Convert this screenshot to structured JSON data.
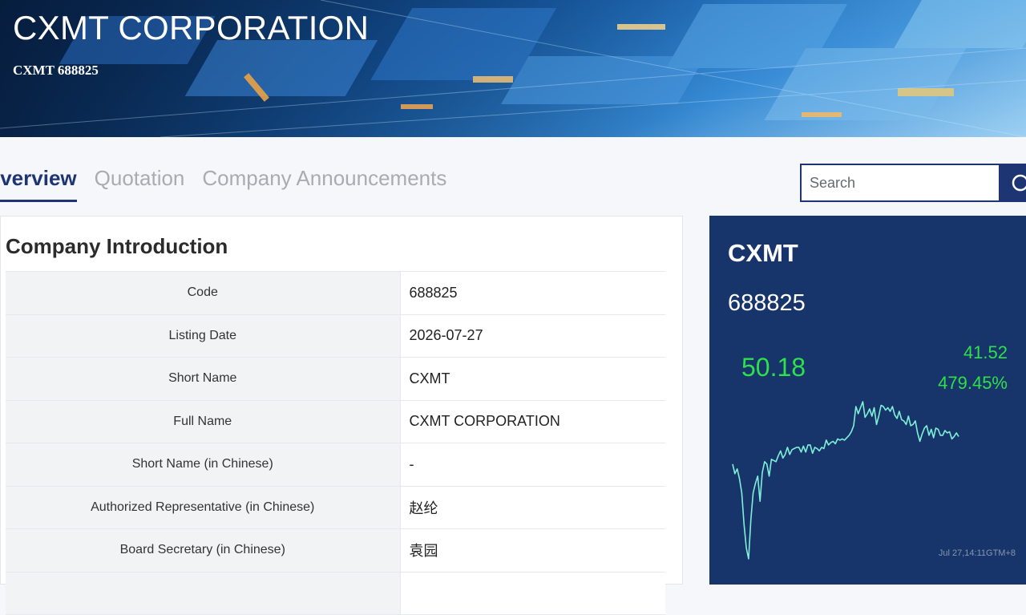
{
  "hero": {
    "title": "CXMT CORPORATION",
    "subtitle": "CXMT 688825"
  },
  "tabs": [
    {
      "label": "Overview",
      "active": true
    },
    {
      "label": "Quotation",
      "active": false
    },
    {
      "label": "Company Announcements",
      "active": false
    }
  ],
  "search": {
    "placeholder": "Search",
    "value": ""
  },
  "intro": {
    "title": "Company Introduction",
    "rows": [
      {
        "key": "Code",
        "value": "688825"
      },
      {
        "key": "Listing Date",
        "value": "2026-07-27"
      },
      {
        "key": "Short Name",
        "value": "CXMT"
      },
      {
        "key": "Full Name",
        "value": "CXMT CORPORATION"
      },
      {
        "key": "Short Name (in Chinese)",
        "value": "-"
      },
      {
        "key": "Authorized Representative (in Chinese)",
        "value": "赵纶"
      },
      {
        "key": "Board Secretary (in Chinese)",
        "value": "袁园"
      },
      {
        "key": "",
        "value": ""
      }
    ]
  },
  "quote": {
    "short_name": "CXMT",
    "code": "688825",
    "price": "50.18",
    "change": "41.52",
    "change_pct": "479.45%",
    "timestamp": "Jul 27,14:11GTM+8"
  },
  "colors": {
    "accent": "#1d3572",
    "quote_bg": "#17356b",
    "up_green": "#2ee04a",
    "chart_line": "#7ff0d8"
  },
  "icons": {
    "search": "search-icon"
  },
  "chart_data": {
    "type": "line",
    "title": "",
    "xlabel": "",
    "ylabel": "",
    "x": [
      0,
      1,
      2,
      3,
      4,
      5,
      6,
      7,
      8,
      9,
      10,
      11,
      12,
      13,
      14,
      15,
      16,
      17,
      18,
      19,
      20,
      21,
      22,
      23,
      24,
      25,
      26,
      27,
      28,
      29,
      30,
      31,
      32,
      33,
      34,
      35,
      36,
      37,
      38,
      39,
      40,
      41,
      42,
      43,
      44,
      45,
      46,
      47,
      48,
      49,
      50,
      51,
      52,
      53,
      54,
      55,
      56,
      57,
      58,
      59,
      60,
      61,
      62,
      63,
      64,
      65,
      66,
      67,
      68,
      69,
      70,
      71,
      72,
      73,
      74,
      75,
      76,
      77,
      78,
      79,
      80,
      81,
      82,
      83,
      84,
      85,
      86,
      87,
      88,
      89,
      90,
      91,
      92,
      93,
      94,
      95,
      96,
      97,
      98,
      99
    ],
    "series": [
      {
        "values": [
          46.6,
          45.8,
          46.2,
          45.4,
          44.2,
          41.6,
          39.6,
          38.7,
          42.0,
          44.2,
          45.0,
          45.6,
          43.5,
          45.9,
          46.8,
          46.6,
          45.6,
          47.0,
          46.9,
          46.8,
          47.3,
          47.7,
          47.1,
          47.4,
          48.0,
          47.4,
          47.8,
          47.9,
          48.0,
          48.0,
          47.6,
          48.1,
          47.6,
          48.2,
          48.2,
          47.5,
          48.0,
          47.9,
          47.7,
          48.0,
          47.9,
          48.6,
          48.2,
          48.4,
          48.5,
          48.3,
          48.7,
          48.6,
          48.7,
          48.6,
          48.8,
          49.0,
          49.3,
          49.8,
          51.4,
          50.8,
          51.3,
          51.8,
          50.5,
          50.8,
          51.2,
          50.6,
          51.3,
          49.9,
          50.6,
          51.5,
          51.4,
          51.1,
          51.3,
          51.0,
          51.4,
          50.7,
          50.4,
          51.0,
          50.3,
          50.2,
          49.9,
          50.6,
          49.8,
          49.9,
          50.2,
          49.2,
          48.5,
          49.1,
          49.6,
          49.8,
          49.0,
          49.5,
          48.8,
          49.6,
          49.5,
          49.0,
          49.0,
          49.4,
          49.2,
          49.3,
          48.7,
          48.9,
          49.2,
          48.9
        ]
      }
    ],
    "grid": false,
    "legend": "none"
  }
}
